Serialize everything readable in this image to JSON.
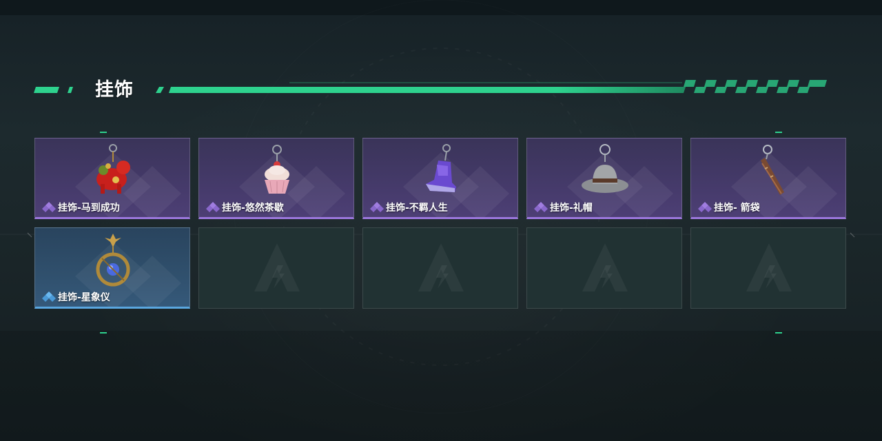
{
  "section": {
    "title": "挂饰"
  },
  "colors": {
    "accent": "#2ed28e",
    "purple_rarity": "#9b77dc",
    "blue_rarity": "#5aa7e0",
    "empty_slot": "#213233"
  },
  "items": [
    {
      "label": "挂饰-马到成功",
      "rarity": "purple",
      "icon": "red-horse-charm"
    },
    {
      "label": "挂饰-悠然茶歇",
      "rarity": "purple",
      "icon": "cupcake-charm"
    },
    {
      "label": "挂饰-不羁人生",
      "rarity": "purple",
      "icon": "sneaker-charm"
    },
    {
      "label": "挂饰-礼帽",
      "rarity": "purple",
      "icon": "fedora-hat-charm"
    },
    {
      "label": "挂饰- 箭袋",
      "rarity": "purple",
      "icon": "quiver-charm"
    },
    {
      "label": "挂饰-星象仪",
      "rarity": "blue",
      "icon": "astrolabe-charm"
    }
  ],
  "empty_slots": 4
}
